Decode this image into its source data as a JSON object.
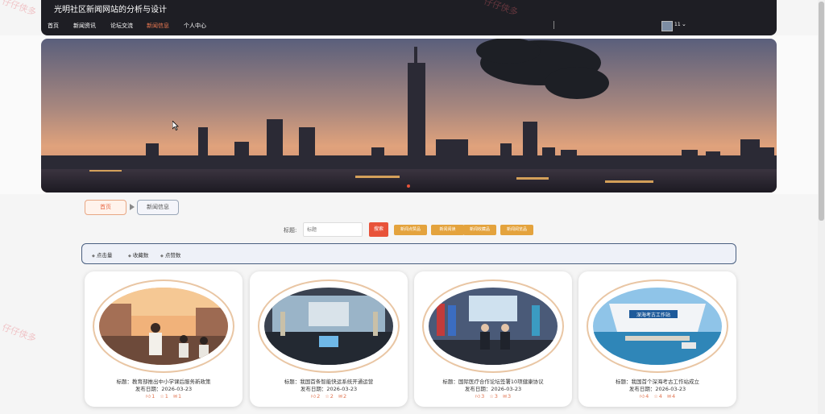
{
  "site": {
    "title": "光明社区新闻网站的分析与设计"
  },
  "nav": {
    "items": [
      {
        "label": "首页",
        "active": false
      },
      {
        "label": "新闻资讯",
        "active": false
      },
      {
        "label": "论坛交流",
        "active": false
      },
      {
        "label": "新闻信息",
        "active": true
      },
      {
        "label": "个人中心",
        "active": false
      }
    ],
    "user": {
      "name": "11",
      "avatar_icon": "avatar-icon",
      "dropdown_icon": "chevron-down-icon"
    },
    "active_color": "#ef7a52"
  },
  "breadcrumb": {
    "home": "首页",
    "current": "新闻信息"
  },
  "search": {
    "label": "标题:",
    "placeholder": "标题",
    "button": "搜索",
    "filters": [
      "新闻点赞品",
      "新闻阅读",
      "新闻收藏品",
      "新闻阅览品"
    ]
  },
  "sort": {
    "items": [
      "点击量",
      "收藏数",
      "点赞数"
    ]
  },
  "cards": [
    {
      "title": "标题：教育部推出中小学课后服务新政策",
      "date": "发布日期：2026-03-23",
      "likes": "1",
      "favorites": "1",
      "comments": "1"
    },
    {
      "title": "标题：我国首条智能快运系统开通运营",
      "date": "发布日期：2026-03-23",
      "likes": "2",
      "favorites": "2",
      "comments": "2"
    },
    {
      "title": "标题：国际医疗合作论坛签署10项健康协议",
      "date": "发布日期：2026-03-23",
      "likes": "3",
      "favorites": "3",
      "comments": "3"
    },
    {
      "title": "标题：我国首个深海考古工作站成立",
      "date": "发布日期：2026-03-23",
      "likes": "4",
      "favorites": "4",
      "comments": "4"
    }
  ],
  "card4_sign": "深海考古工作站",
  "watermark": "仔仔侠多",
  "colors": {
    "accent": "#e8533a",
    "filter": "#e4a33d",
    "topbar": "#1e1e24",
    "stats": "#e0734f"
  }
}
